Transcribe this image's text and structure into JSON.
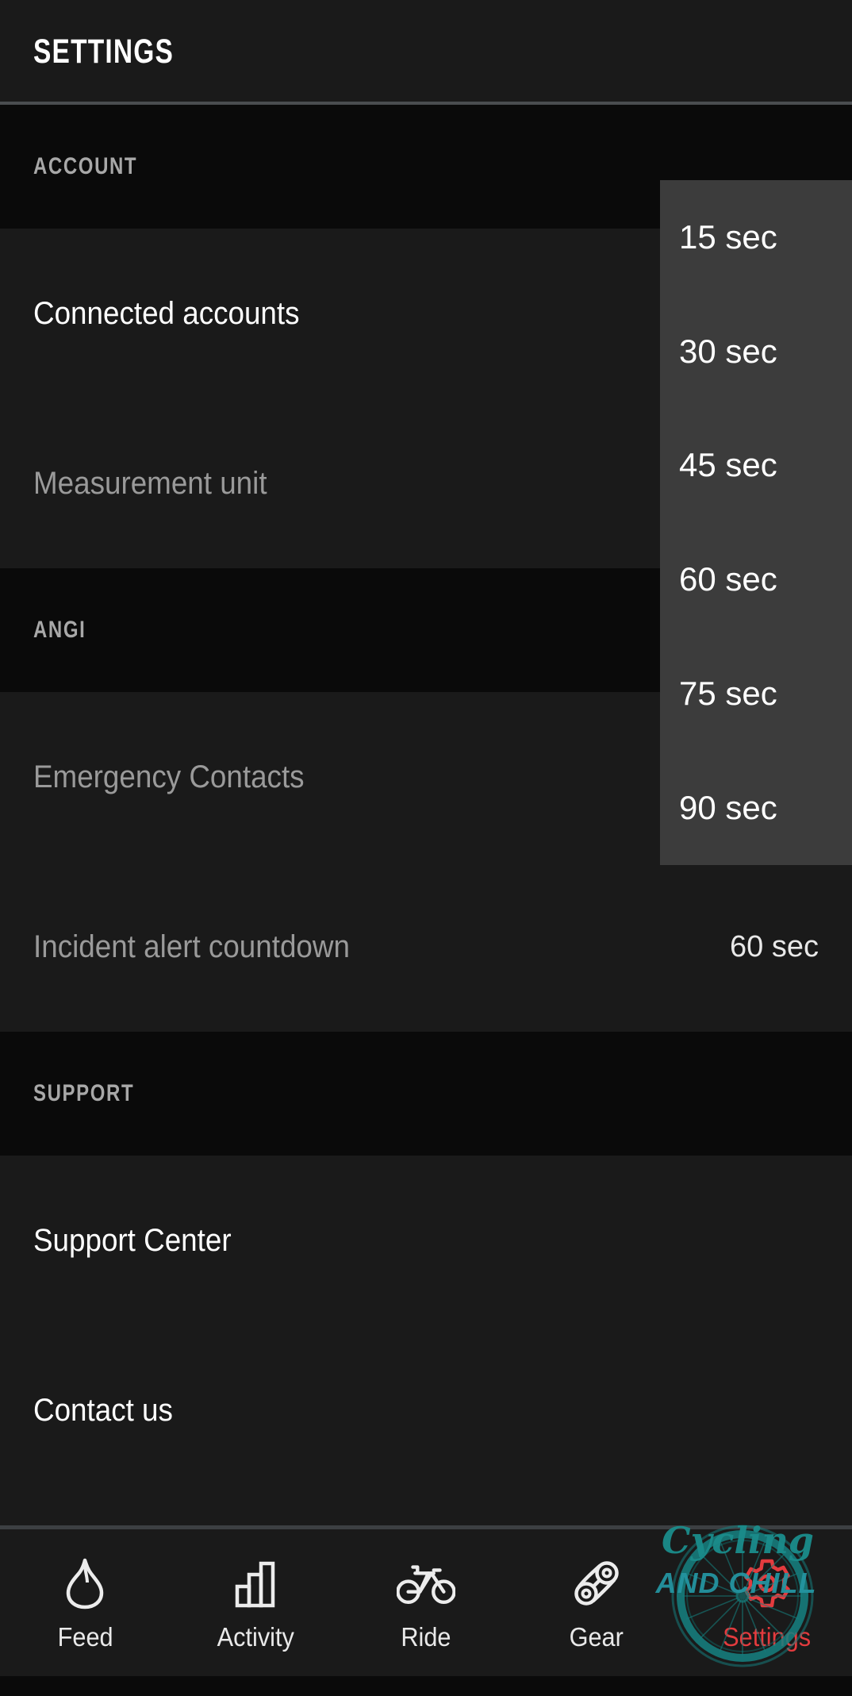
{
  "header": {
    "title": "SETTINGS"
  },
  "sections": [
    {
      "id": "account",
      "label": "ACCOUNT",
      "rows": [
        {
          "label": "Connected accounts",
          "value": "",
          "dim": false
        },
        {
          "label": "Measurement unit",
          "value": "",
          "dim": true
        }
      ]
    },
    {
      "id": "angi",
      "label": "ANGI",
      "rows": [
        {
          "label": "Emergency Contacts",
          "value": "",
          "dim": true
        },
        {
          "label": "Incident alert countdown",
          "value": "60 sec",
          "dim": true
        }
      ]
    },
    {
      "id": "support",
      "label": "SUPPORT",
      "rows": [
        {
          "label": "Support Center",
          "value": "",
          "dim": false
        },
        {
          "label": "Contact us",
          "value": "",
          "dim": false
        }
      ]
    }
  ],
  "dropdown": {
    "name": "incident-alert-countdown-options",
    "selected": "60 sec",
    "options": [
      "15 sec",
      "30 sec",
      "45 sec",
      "60 sec",
      "75 sec",
      "90 sec"
    ],
    "background_color": "#3c3c3c"
  },
  "navbar": {
    "active": "Settings",
    "items": [
      {
        "label": "Feed",
        "icon": "flame-icon"
      },
      {
        "label": "Activity",
        "icon": "bar-chart-icon"
      },
      {
        "label": "Ride",
        "icon": "bicycle-icon"
      },
      {
        "label": "Gear",
        "icon": "chain-link-icon"
      },
      {
        "label": "Settings",
        "icon": "gear-icon"
      }
    ]
  },
  "watermark": {
    "script_text": "Cycling",
    "bold_text": "AND CHILL",
    "teal_color": "#16807f",
    "red_color": "#e43b3e"
  },
  "colors": {
    "page_background": "#1a1a1a",
    "section_header_background": "#0a0a0a",
    "divider": "#4a4d50",
    "primary_text": "#ffffff",
    "muted_text": "#9a9a9a",
    "section_label_text": "#a8a8a8",
    "accent": "#e43b3e"
  }
}
